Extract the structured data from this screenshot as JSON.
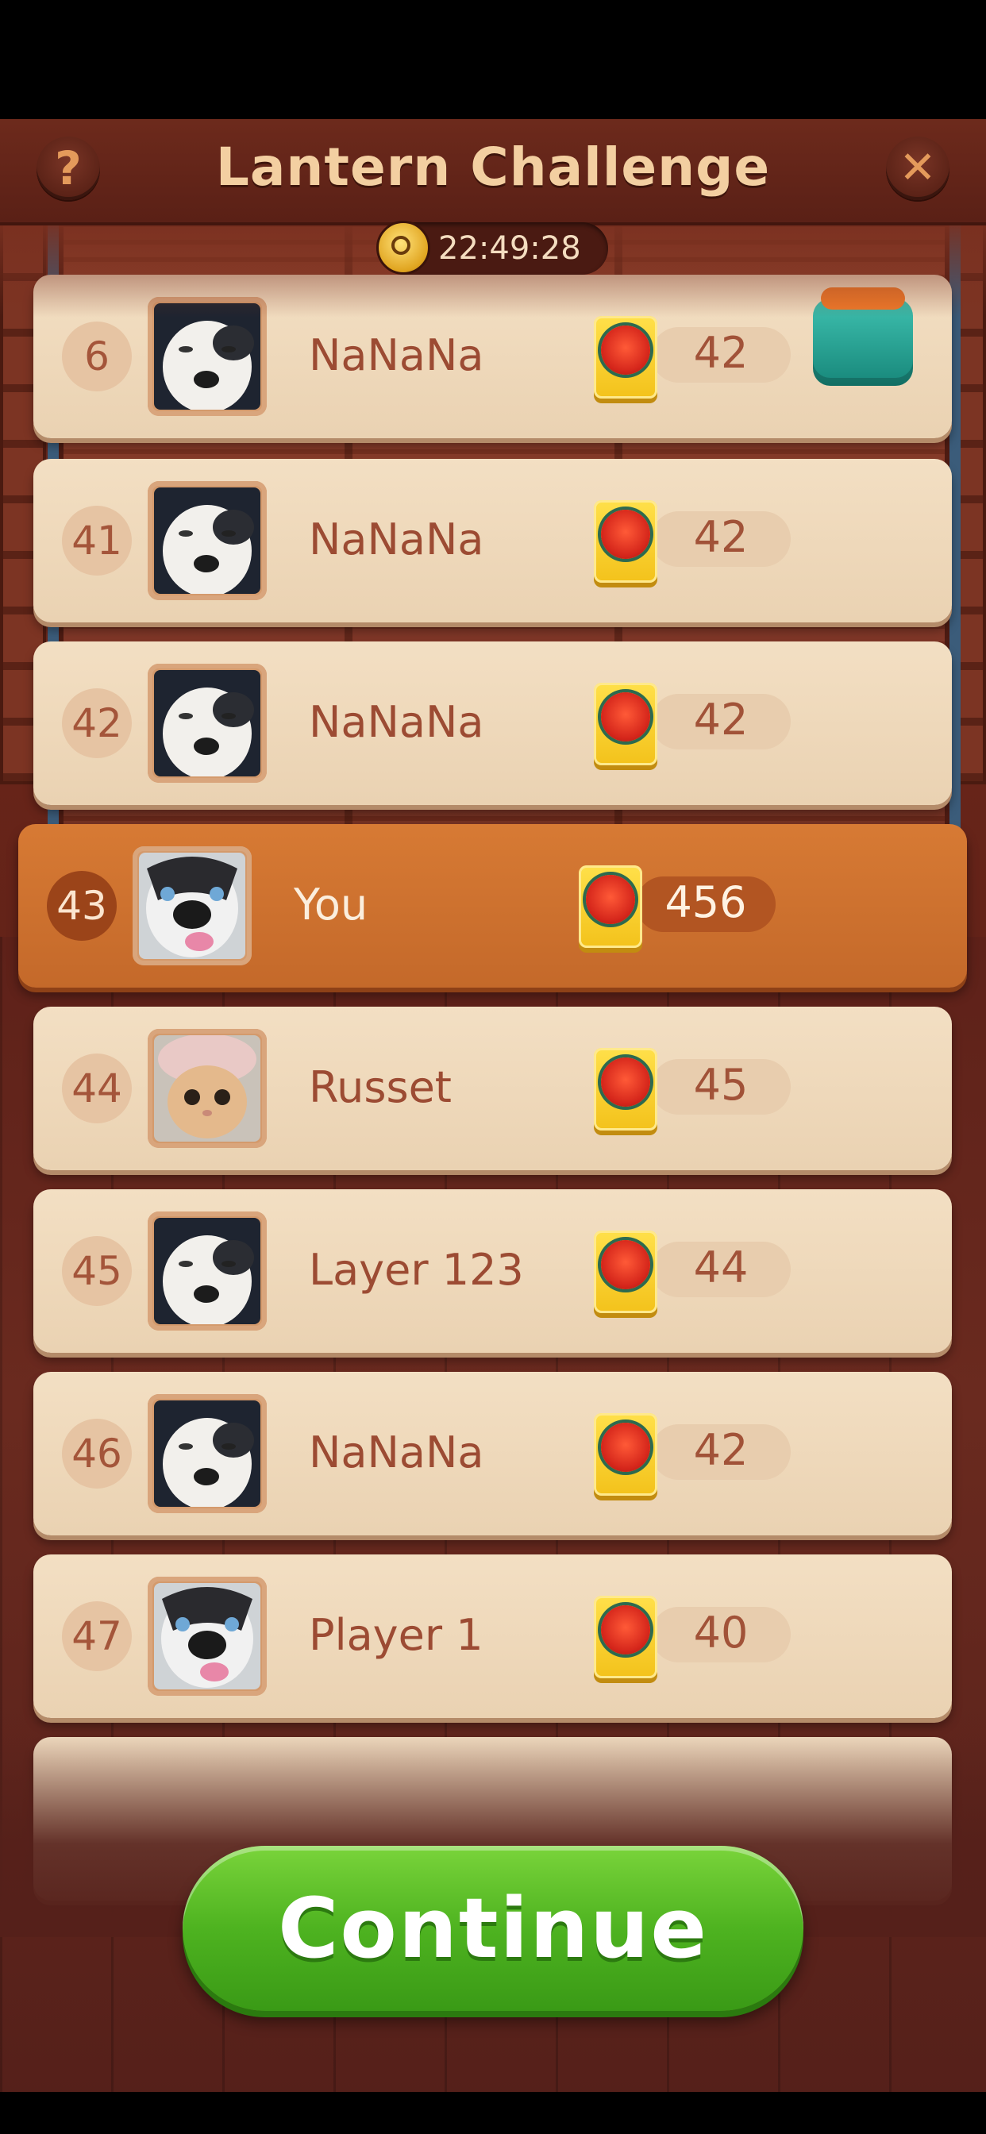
{
  "header": {
    "title": "Lantern Challenge",
    "help_icon": "?",
    "close_icon": "✕"
  },
  "timer": {
    "icon": "stopwatch-icon",
    "value": "22:49:28"
  },
  "leaderboard": [
    {
      "rank": "6",
      "name": "NaNaNa",
      "score": "42",
      "avatar": "dog-avatar",
      "reward": "gift-box"
    },
    {
      "rank": "41",
      "name": "NaNaNa",
      "score": "42",
      "avatar": "dog-avatar"
    },
    {
      "rank": "42",
      "name": "NaNaNa",
      "score": "42",
      "avatar": "dog-avatar"
    },
    {
      "rank": "43",
      "name": "You",
      "score": "456",
      "avatar": "husky-avatar",
      "is_player": true
    },
    {
      "rank": "44",
      "name": "Russet",
      "score": "45",
      "avatar": "cat-avatar"
    },
    {
      "rank": "45",
      "name": "Layer 123",
      "score": "44",
      "avatar": "dog-avatar"
    },
    {
      "rank": "46",
      "name": "NaNaNa",
      "score": "42",
      "avatar": "dog-avatar"
    },
    {
      "rank": "47",
      "name": "Player 1",
      "score": "40",
      "avatar": "husky-avatar"
    }
  ],
  "continue_button": {
    "label": "Continue"
  },
  "colors": {
    "accent_orange": "#c96d2c",
    "button_green": "#4eb320",
    "row_bg": "#f0dabd",
    "title_color": "#f3cfa1"
  }
}
